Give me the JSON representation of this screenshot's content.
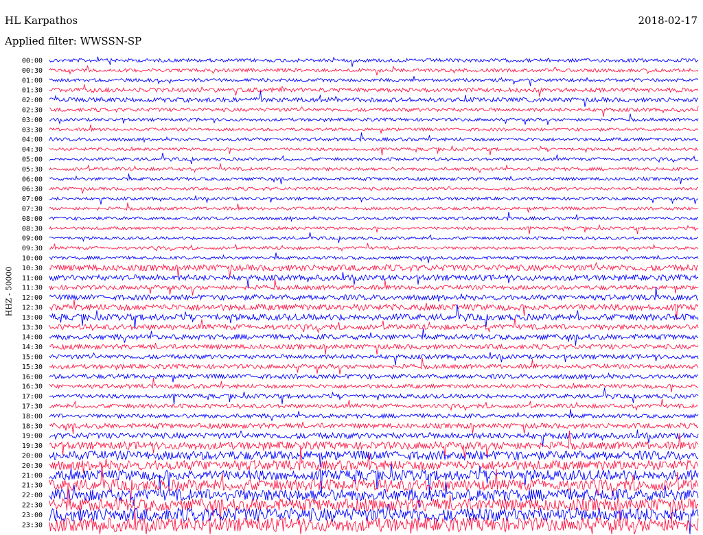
{
  "header": {
    "station": "HL Karpathos",
    "date": "2018-02-17",
    "filter_label": "Applied filter:",
    "filter_value": "WWSSN-SP"
  },
  "chart_data": {
    "type": "line",
    "title": "HL Karpathos",
    "subtitle": "Applied filter: WWSSN-SP",
    "ylabel": "HHZ - 50000",
    "row_labels": [
      "00:00",
      "00:30",
      "01:00",
      "01:30",
      "02:00",
      "02:30",
      "03:00",
      "03:30",
      "04:00",
      "04:30",
      "05:00",
      "05:30",
      "06:00",
      "06:30",
      "07:00",
      "07:30",
      "08:00",
      "08:30",
      "09:00",
      "09:30",
      "10:00",
      "10:30",
      "11:00",
      "11:30",
      "12:00",
      "12:30",
      "13:00",
      "13:30",
      "14:00",
      "14:30",
      "15:00",
      "15:30",
      "16:00",
      "16:30",
      "17:00",
      "17:30",
      "18:00",
      "18:30",
      "19:00",
      "19:30",
      "20:00",
      "20:30",
      "21:00",
      "21:30",
      "22:00",
      "22:30",
      "23:00",
      "23:30"
    ],
    "noise_level": [
      2.5,
      2.5,
      2.3,
      3.0,
      3.2,
      2.6,
      2.2,
      2.2,
      2.4,
      2.2,
      2.2,
      2.3,
      2.3,
      2.2,
      2.2,
      2.2,
      2.3,
      2.1,
      2.1,
      2.1,
      2.3,
      4.5,
      4.0,
      3.2,
      3.8,
      4.5,
      4.5,
      3.8,
      3.8,
      3.5,
      3.2,
      3.2,
      3.3,
      3.0,
      3.0,
      3.0,
      3.0,
      3.6,
      4.2,
      5.5,
      6.5,
      7.0,
      7.5,
      8.0,
      8.5,
      9.0,
      9.5,
      10.0
    ],
    "series_colors": [
      "#0000ff",
      "#ff1744"
    ]
  }
}
